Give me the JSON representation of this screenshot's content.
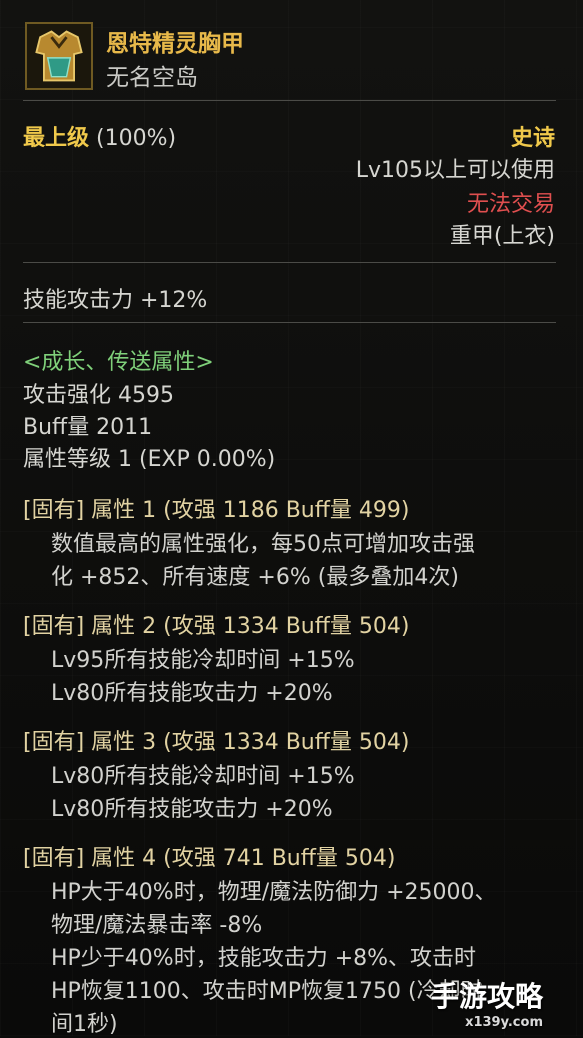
{
  "header": {
    "item_name": "恩特精灵胸甲",
    "item_sub": "无名空岛"
  },
  "info": {
    "grade_label": "最上级",
    "grade_pct": "(100%)",
    "rarity": "史诗",
    "level_req": "Lv105以上可以使用",
    "trade": "无法交易",
    "slot": "重甲(上衣)"
  },
  "stat_line": "技能攻击力  +12%",
  "growth": {
    "title": "<成长、传送属性>",
    "lines": [
      "攻击强化 4595",
      "Buff量 2011",
      "属性等级 1 (EXP 0.00%)"
    ]
  },
  "attributes": [
    {
      "header": "[固有] 属性 1 (攻强 1186    Buff量 499)",
      "lines": [
        "数值最高的属性强化，每50点可增加攻击强",
        "化 +852、所有速度 +6% (最多叠加4次)"
      ]
    },
    {
      "header": "[固有] 属性 2 (攻强 1334    Buff量 504)",
      "lines": [
        "Lv95所有技能冷却时间 +15%",
        "Lv80所有技能攻击力 +20%"
      ]
    },
    {
      "header": "[固有] 属性 3 (攻强 1334    Buff量 504)",
      "lines": [
        "Lv80所有技能冷却时间 +15%",
        "Lv80所有技能攻击力 +20%"
      ]
    },
    {
      "header": "[固有] 属性 4 (攻强 741    Buff量 504)",
      "lines": [
        "HP大于40%时，物理/魔法防御力 +25000、",
        "物理/魔法暴击率 -8%",
        "HP少于40%时，技能攻击力 +8%、攻击时",
        "HP恢复1100、攻击时MP恢复1750 (冷却时",
        "间1秒)"
      ]
    }
  ],
  "watermark": {
    "text": "手游攻略",
    "sub": "x139y.com"
  },
  "colors": {
    "gold": "#f0c94b",
    "red": "#e04f4f",
    "green": "#7fd07a",
    "tan": "#e2d3a3"
  }
}
